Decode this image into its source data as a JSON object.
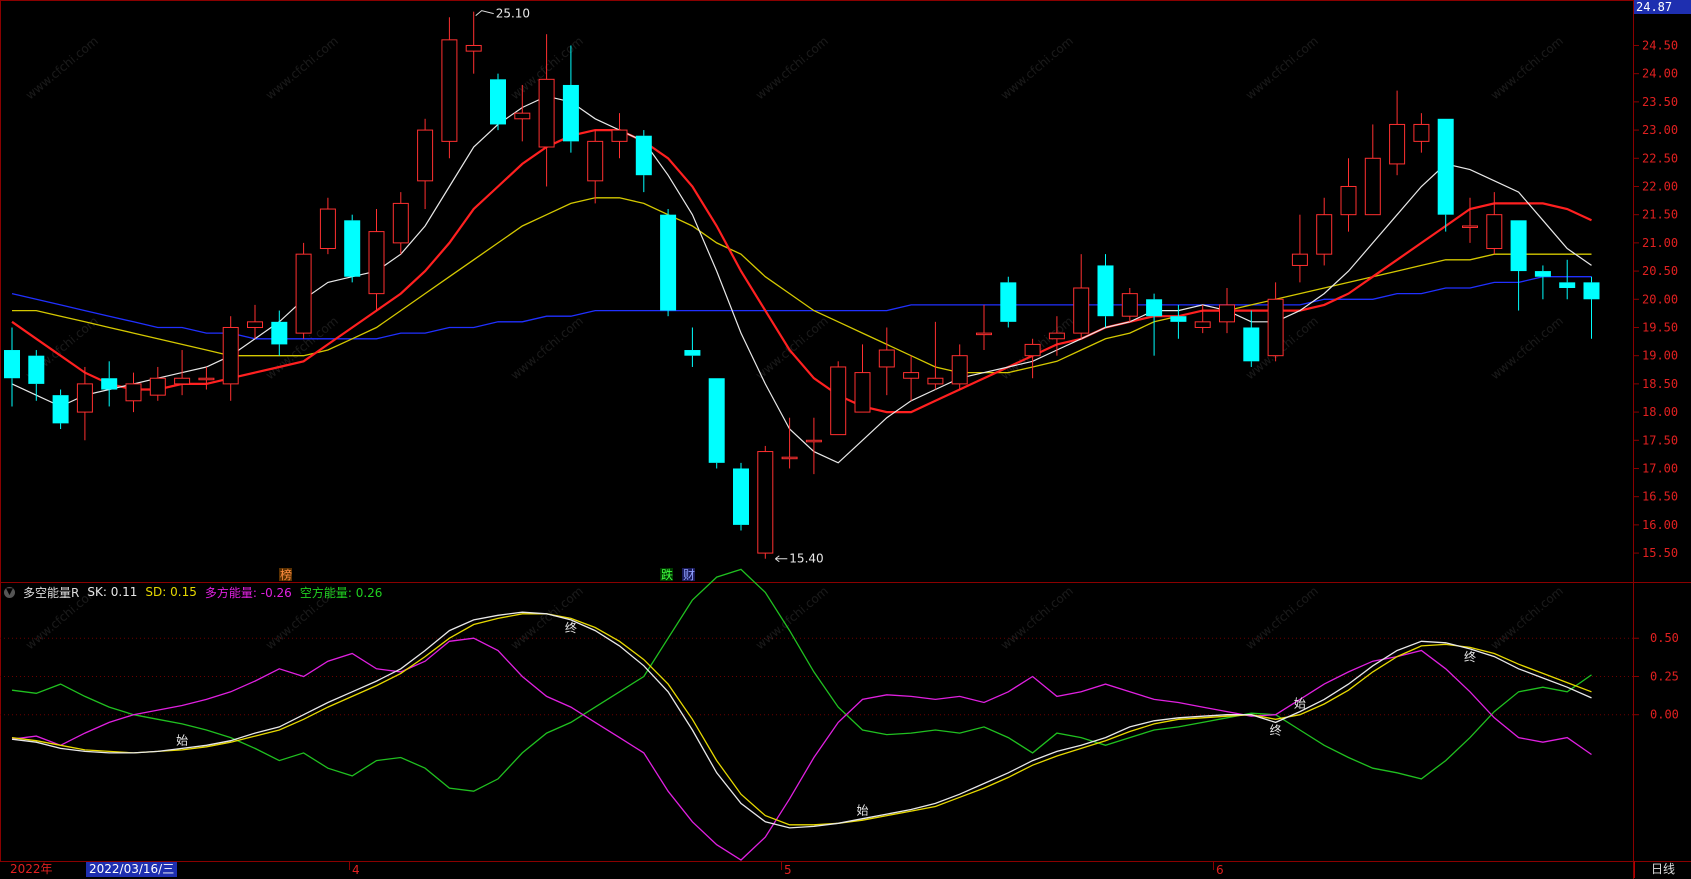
{
  "watermark": "www.cfchi.com",
  "price_panel": {
    "axis_ticks": [
      "24.50",
      "24.00",
      "23.50",
      "23.00",
      "22.50",
      "22.00",
      "21.50",
      "21.00",
      "20.50",
      "20.00",
      "19.50",
      "19.00",
      "18.50",
      "18.00",
      "17.50",
      "17.00",
      "16.50",
      "16.00",
      "15.50"
    ],
    "top_value": "24.87",
    "high_label": "25.10",
    "low_label": "15.40",
    "marker_bang": "榜",
    "marker_die": "跌",
    "marker_cai": "财"
  },
  "indicator_panel": {
    "name": "多空能量R",
    "sk_label": "SK:",
    "sk_value": "0.11",
    "sd_label": "SD:",
    "sd_value": "0.15",
    "duo_label": "多方能量:",
    "duo_value": "-0.26",
    "kong_label": "空方能量:",
    "kong_value": "0.26",
    "axis_ticks": [
      "0.50",
      "0.25",
      "0.00"
    ],
    "signal_shi": "始",
    "signal_zhong": "终"
  },
  "footer": {
    "year": "2022年",
    "cursor_date": "2022/03/16/三",
    "month_ticks": [
      "4",
      "5",
      "6"
    ],
    "period": "日线"
  },
  "colors": {
    "up": "#ff3030",
    "down": "#00ffff",
    "ma5": "#e8e8e8",
    "ma10": "#ff2020",
    "ma20": "#d4c800",
    "ma60": "#2030ff",
    "sk": "#e8e8e8",
    "sd": "#e6d800",
    "duo": "#e020e0",
    "kong": "#20c020",
    "grid": "#8a0000"
  },
  "chart_data": [
    {
      "type": "candlestick",
      "ylim": [
        15.2,
        25.2
      ],
      "candles": [
        [
          19.1,
          18.6,
          19.5,
          18.1
        ],
        [
          19.0,
          18.5,
          19.1,
          18.2
        ],
        [
          18.3,
          17.8,
          18.4,
          17.7
        ],
        [
          18.0,
          18.5,
          18.8,
          17.5
        ],
        [
          18.6,
          18.4,
          18.9,
          18.1
        ],
        [
          18.2,
          18.5,
          18.7,
          18.0
        ],
        [
          18.3,
          18.6,
          18.8,
          18.2
        ],
        [
          18.5,
          18.6,
          19.1,
          18.3
        ],
        [
          18.6,
          18.6,
          18.8,
          18.4
        ],
        [
          18.5,
          19.5,
          19.7,
          18.2
        ],
        [
          19.5,
          19.6,
          19.9,
          19.3
        ],
        [
          19.6,
          19.2,
          19.8,
          19.0
        ],
        [
          19.4,
          20.8,
          21.0,
          19.3
        ],
        [
          20.9,
          21.6,
          21.8,
          20.8
        ],
        [
          21.4,
          20.4,
          21.5,
          20.3
        ],
        [
          20.1,
          21.2,
          21.6,
          19.8
        ],
        [
          21.0,
          21.7,
          21.9,
          20.8
        ],
        [
          22.1,
          23.0,
          23.2,
          21.6
        ],
        [
          22.8,
          24.6,
          25.0,
          22.5
        ],
        [
          24.4,
          24.5,
          25.1,
          24.0
        ],
        [
          23.9,
          23.1,
          24.0,
          23.0
        ],
        [
          23.2,
          23.3,
          23.8,
          22.8
        ],
        [
          22.7,
          23.9,
          24.7,
          22.0
        ],
        [
          23.8,
          22.8,
          24.5,
          22.6
        ],
        [
          22.1,
          22.8,
          23.0,
          21.7
        ],
        [
          22.8,
          23.0,
          23.3,
          22.5
        ],
        [
          22.9,
          22.2,
          23.0,
          21.9
        ],
        [
          21.5,
          19.8,
          21.6,
          19.7
        ],
        [
          19.1,
          19.0,
          19.5,
          18.8
        ],
        [
          18.6,
          17.1,
          18.6,
          17.0
        ],
        [
          17.0,
          16.0,
          17.1,
          15.9
        ],
        [
          15.5,
          17.3,
          17.4,
          15.4
        ],
        [
          17.2,
          17.2,
          17.9,
          17.0
        ],
        [
          17.5,
          17.5,
          17.9,
          16.9
        ],
        [
          17.6,
          18.8,
          18.9,
          17.6
        ],
        [
          18.0,
          18.7,
          19.2,
          18.0
        ],
        [
          18.8,
          19.1,
          19.5,
          18.3
        ],
        [
          18.6,
          18.7,
          19.0,
          18.2
        ],
        [
          18.5,
          18.6,
          19.6,
          18.4
        ],
        [
          18.5,
          19.0,
          19.2,
          18.4
        ],
        [
          19.4,
          19.4,
          19.9,
          19.1
        ],
        [
          20.3,
          19.6,
          20.4,
          19.5
        ],
        [
          19.0,
          19.2,
          19.3,
          18.6
        ],
        [
          19.3,
          19.4,
          19.7,
          19.0
        ],
        [
          19.4,
          20.2,
          20.8,
          19.3
        ],
        [
          20.6,
          19.7,
          20.8,
          19.5
        ],
        [
          19.7,
          20.1,
          20.2,
          19.6
        ],
        [
          20.0,
          19.7,
          20.1,
          19.0
        ],
        [
          19.7,
          19.6,
          19.9,
          19.3
        ],
        [
          19.5,
          19.6,
          19.9,
          19.4
        ],
        [
          19.6,
          19.9,
          20.2,
          19.4
        ],
        [
          19.5,
          18.9,
          19.8,
          18.8
        ],
        [
          19.0,
          20.0,
          20.3,
          18.9
        ],
        [
          20.6,
          20.8,
          21.5,
          20.3
        ],
        [
          20.8,
          21.5,
          21.8,
          20.6
        ],
        [
          21.5,
          22.0,
          22.5,
          21.2
        ],
        [
          21.5,
          22.5,
          23.1,
          21.5
        ],
        [
          22.4,
          23.1,
          23.7,
          22.2
        ],
        [
          22.8,
          23.1,
          23.3,
          22.6
        ],
        [
          23.2,
          21.5,
          23.2,
          21.2
        ],
        [
          21.3,
          21.3,
          21.8,
          21.0
        ],
        [
          20.9,
          21.5,
          21.9,
          20.8
        ],
        [
          21.4,
          20.5,
          21.4,
          19.8
        ],
        [
          20.5,
          20.4,
          20.6,
          20.0
        ],
        [
          20.3,
          20.2,
          20.7,
          20.0
        ],
        [
          20.3,
          20.0,
          20.4,
          19.3
        ]
      ],
      "ma5": [
        18.5,
        18.3,
        18.1,
        18.3,
        18.4,
        18.5,
        18.6,
        18.7,
        18.8,
        19.0,
        19.3,
        19.6,
        20.0,
        20.3,
        20.4,
        20.5,
        20.8,
        21.3,
        22.0,
        22.7,
        23.1,
        23.4,
        23.6,
        23.5,
        23.2,
        23.0,
        22.8,
        22.2,
        21.5,
        20.5,
        19.4,
        18.5,
        17.7,
        17.3,
        17.1,
        17.5,
        17.9,
        18.2,
        18.4,
        18.6,
        18.7,
        18.8,
        18.9,
        19.1,
        19.3,
        19.5,
        19.6,
        19.8,
        19.8,
        19.9,
        19.8,
        19.6,
        19.6,
        19.8,
        20.1,
        20.5,
        21.0,
        21.5,
        22.0,
        22.4,
        22.3,
        22.1,
        21.9,
        21.4,
        20.9,
        20.6
      ],
      "ma10": [
        19.6,
        19.3,
        19.0,
        18.7,
        18.5,
        18.4,
        18.4,
        18.5,
        18.5,
        18.6,
        18.7,
        18.8,
        18.9,
        19.2,
        19.5,
        19.8,
        20.1,
        20.5,
        21.0,
        21.6,
        22.0,
        22.4,
        22.7,
        22.9,
        23.0,
        23.0,
        22.8,
        22.5,
        22.0,
        21.3,
        20.5,
        19.8,
        19.1,
        18.6,
        18.3,
        18.1,
        18.0,
        18.0,
        18.2,
        18.4,
        18.6,
        18.8,
        19.0,
        19.2,
        19.3,
        19.5,
        19.6,
        19.7,
        19.7,
        19.8,
        19.8,
        19.8,
        19.8,
        19.8,
        19.9,
        20.1,
        20.4,
        20.7,
        21.0,
        21.3,
        21.6,
        21.7,
        21.7,
        21.7,
        21.6,
        21.4
      ],
      "ma20": [
        19.8,
        19.8,
        19.7,
        19.6,
        19.5,
        19.4,
        19.3,
        19.2,
        19.1,
        19.0,
        19.0,
        19.0,
        19.0,
        19.1,
        19.3,
        19.5,
        19.8,
        20.1,
        20.4,
        20.7,
        21.0,
        21.3,
        21.5,
        21.7,
        21.8,
        21.8,
        21.7,
        21.5,
        21.3,
        21.0,
        20.8,
        20.4,
        20.1,
        19.8,
        19.6,
        19.4,
        19.2,
        19.0,
        18.8,
        18.7,
        18.7,
        18.7,
        18.8,
        18.9,
        19.1,
        19.3,
        19.4,
        19.6,
        19.7,
        19.8,
        19.8,
        19.9,
        20.0,
        20.1,
        20.2,
        20.3,
        20.4,
        20.5,
        20.6,
        20.7,
        20.7,
        20.8,
        20.8,
        20.8,
        20.8,
        20.8
      ],
      "ma60": [
        20.1,
        20.0,
        19.9,
        19.8,
        19.7,
        19.6,
        19.5,
        19.5,
        19.4,
        19.4,
        19.3,
        19.3,
        19.3,
        19.3,
        19.3,
        19.3,
        19.4,
        19.4,
        19.5,
        19.5,
        19.6,
        19.6,
        19.7,
        19.7,
        19.8,
        19.8,
        19.8,
        19.8,
        19.8,
        19.8,
        19.8,
        19.8,
        19.8,
        19.8,
        19.8,
        19.8,
        19.8,
        19.9,
        19.9,
        19.9,
        19.9,
        19.9,
        19.9,
        19.9,
        19.9,
        19.9,
        19.9,
        19.9,
        19.9,
        19.9,
        19.9,
        19.9,
        19.9,
        19.9,
        20.0,
        20.0,
        20.0,
        20.1,
        20.1,
        20.2,
        20.2,
        20.3,
        20.3,
        20.4,
        20.4,
        20.4
      ]
    },
    {
      "type": "line",
      "ylim": [
        -0.95,
        0.75
      ],
      "series": [
        {
          "name": "SK",
          "values": [
            -0.16,
            -0.18,
            -0.22,
            -0.24,
            -0.25,
            -0.25,
            -0.24,
            -0.22,
            -0.2,
            -0.17,
            -0.12,
            -0.08,
            0.0,
            0.08,
            0.15,
            0.22,
            0.3,
            0.42,
            0.55,
            0.62,
            0.65,
            0.67,
            0.66,
            0.62,
            0.55,
            0.45,
            0.32,
            0.15,
            -0.1,
            -0.38,
            -0.58,
            -0.7,
            -0.74,
            -0.73,
            -0.71,
            -0.68,
            -0.65,
            -0.62,
            -0.58,
            -0.52,
            -0.45,
            -0.38,
            -0.3,
            -0.24,
            -0.2,
            -0.15,
            -0.08,
            -0.04,
            -0.02,
            -0.01,
            0.0,
            0.0,
            -0.05,
            0.02,
            0.1,
            0.2,
            0.32,
            0.42,
            0.48,
            0.47,
            0.43,
            0.38,
            0.3,
            0.24,
            0.18,
            0.11
          ]
        },
        {
          "name": "SD",
          "values": [
            -0.15,
            -0.17,
            -0.2,
            -0.23,
            -0.24,
            -0.25,
            -0.24,
            -0.23,
            -0.21,
            -0.18,
            -0.14,
            -0.1,
            -0.03,
            0.05,
            0.12,
            0.19,
            0.27,
            0.38,
            0.5,
            0.59,
            0.63,
            0.66,
            0.66,
            0.63,
            0.57,
            0.48,
            0.36,
            0.2,
            -0.03,
            -0.3,
            -0.52,
            -0.66,
            -0.72,
            -0.72,
            -0.71,
            -0.69,
            -0.66,
            -0.63,
            -0.6,
            -0.54,
            -0.48,
            -0.41,
            -0.33,
            -0.27,
            -0.22,
            -0.17,
            -0.11,
            -0.06,
            -0.03,
            -0.02,
            -0.01,
            0.0,
            -0.03,
            0.0,
            0.07,
            0.16,
            0.28,
            0.38,
            0.45,
            0.46,
            0.44,
            0.4,
            0.33,
            0.27,
            0.21,
            0.15
          ]
        },
        {
          "name": "多方能量",
          "values": [
            -0.16,
            -0.14,
            -0.2,
            -0.12,
            -0.05,
            0.0,
            0.03,
            0.06,
            0.1,
            0.15,
            0.22,
            0.3,
            0.25,
            0.35,
            0.4,
            0.3,
            0.28,
            0.35,
            0.48,
            0.5,
            0.42,
            0.25,
            0.12,
            0.05,
            -0.05,
            -0.15,
            -0.25,
            -0.5,
            -0.7,
            -0.85,
            -0.95,
            -0.8,
            -0.55,
            -0.28,
            -0.05,
            0.1,
            0.13,
            0.12,
            0.1,
            0.12,
            0.08,
            0.15,
            0.25,
            0.12,
            0.15,
            0.2,
            0.15,
            0.1,
            0.08,
            0.05,
            0.02,
            -0.01,
            0.0,
            0.1,
            0.2,
            0.28,
            0.35,
            0.38,
            0.42,
            0.3,
            0.15,
            -0.02,
            -0.15,
            -0.18,
            -0.15,
            -0.26
          ]
        },
        {
          "name": "空方能量",
          "values": [
            0.16,
            0.14,
            0.2,
            0.12,
            0.05,
            0.0,
            -0.03,
            -0.06,
            -0.1,
            -0.15,
            -0.22,
            -0.3,
            -0.25,
            -0.35,
            -0.4,
            -0.3,
            -0.28,
            -0.35,
            -0.48,
            -0.5,
            -0.42,
            -0.25,
            -0.12,
            -0.05,
            0.05,
            0.15,
            0.25,
            0.5,
            0.75,
            0.9,
            0.95,
            0.8,
            0.55,
            0.28,
            0.05,
            -0.1,
            -0.13,
            -0.12,
            -0.1,
            -0.12,
            -0.08,
            -0.15,
            -0.25,
            -0.12,
            -0.15,
            -0.2,
            -0.15,
            -0.1,
            -0.08,
            -0.05,
            -0.02,
            0.01,
            0.0,
            -0.1,
            -0.2,
            -0.28,
            -0.35,
            -0.38,
            -0.42,
            -0.3,
            -0.15,
            0.02,
            0.15,
            0.18,
            0.15,
            0.26
          ]
        }
      ]
    }
  ]
}
